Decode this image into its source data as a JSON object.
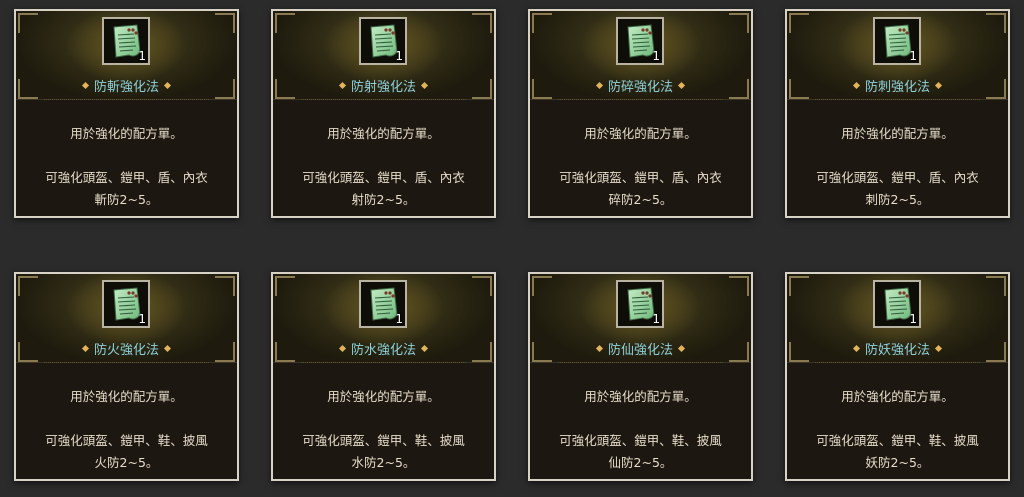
{
  "cards": [
    {
      "title": "防斬強化法",
      "quantity": "1",
      "description": "用於強化的配方單。",
      "detail_line1": "可強化頭盔、鎧甲、盾、內衣",
      "detail_line2": "斬防2~5。"
    },
    {
      "title": "防射強化法",
      "quantity": "1",
      "description": "用於強化的配方單。",
      "detail_line1": "可強化頭盔、鎧甲、盾、內衣",
      "detail_line2": "射防2~5。"
    },
    {
      "title": "防碎強化法",
      "quantity": "1",
      "description": "用於強化的配方單。",
      "detail_line1": "可強化頭盔、鎧甲、盾、內衣",
      "detail_line2": "碎防2~5。"
    },
    {
      "title": "防刺強化法",
      "quantity": "1",
      "description": "用於強化的配方單。",
      "detail_line1": "可強化頭盔、鎧甲、盾、內衣",
      "detail_line2": "刺防2~5。"
    },
    {
      "title": "防火強化法",
      "quantity": "1",
      "description": "用於強化的配方單。",
      "detail_line1": "可強化頭盔、鎧甲、鞋、披風",
      "detail_line2": "火防2~5。"
    },
    {
      "title": "防水強化法",
      "quantity": "1",
      "description": "用於強化的配方單。",
      "detail_line1": "可強化頭盔、鎧甲、鞋、披風",
      "detail_line2": "水防2~5。"
    },
    {
      "title": "防仙強化法",
      "quantity": "1",
      "description": "用於強化的配方單。",
      "detail_line1": "可強化頭盔、鎧甲、鞋、披風",
      "detail_line2": "仙防2~5。"
    },
    {
      "title": "防妖強化法",
      "quantity": "1",
      "description": "用於強化的配方單。",
      "detail_line1": "可強化頭盔、鎧甲、鞋、披風",
      "detail_line2": "妖防2~5。"
    }
  ],
  "icon": "recipe-scroll-icon",
  "colors": {
    "title": "#8fd1d9",
    "text": "#e6ddc8",
    "diamond": "#e2b35a",
    "scroll": "#9fd8a4"
  }
}
